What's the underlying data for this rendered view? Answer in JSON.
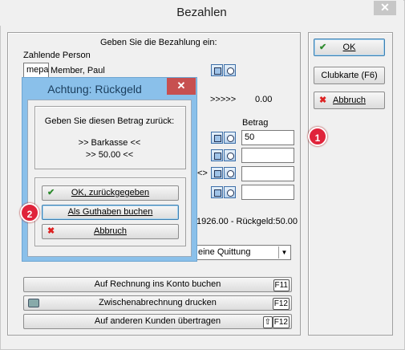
{
  "window": {
    "title": "Bezahlen",
    "close": "✕"
  },
  "main": {
    "instruction": "Geben Sie die Bezahlung ein:",
    "payer_label": "Zahlende Person",
    "payer_code": "mepa",
    "payer_name": "Member, Paul",
    "arrows": ">>>>>",
    "sum_value": "0.00",
    "betrag_header": "Betrag",
    "betrag_values": [
      "50",
      "",
      "",
      ""
    ],
    "mid_arrow": "<>",
    "summary": "1926.00 - Rückgeld:50.00",
    "receipt_select": "eine Quittung",
    "account_button": "Auf Rechnung ins Konto buchen",
    "account_key": "F11",
    "interim_button": "Zwischenabrechnung drucken",
    "interim_key": "F12",
    "transfer_button": "Auf anderen Kunden übertragen",
    "transfer_key": "F12"
  },
  "side": {
    "ok": "OK",
    "clubkarte": "Clubkarte (F6)",
    "abbruch": "Abbruch"
  },
  "dialog": {
    "title": "Achtung: Rückgeld",
    "close": "✕",
    "message": "Geben Sie diesen Betrag zurück:",
    "line1": ">> Barkasse <<",
    "line2": ">> 50.00 <<",
    "btn_ok": "OK, zurückgegeben",
    "btn_credit": "Als Guthaben buchen",
    "btn_cancel": "Abbruch"
  },
  "badges": [
    "1",
    "2"
  ]
}
